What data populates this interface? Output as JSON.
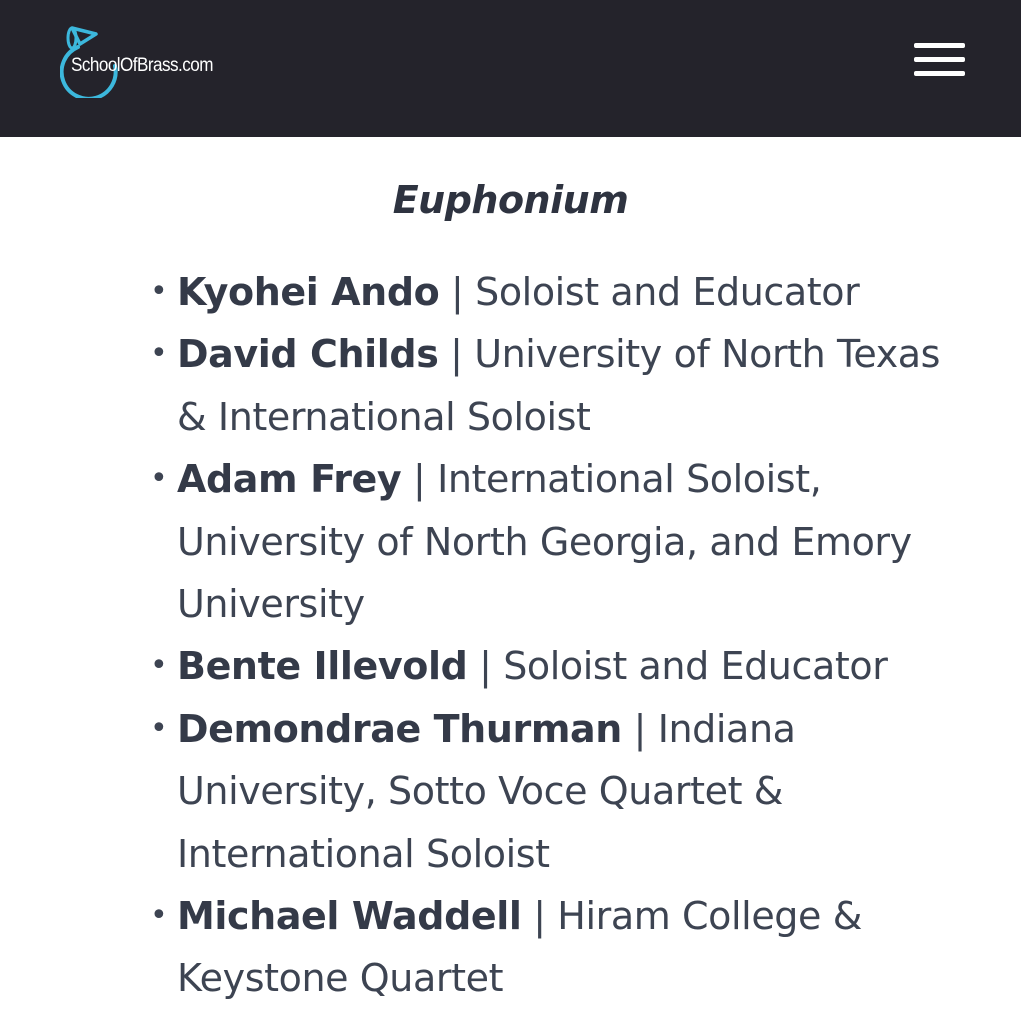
{
  "header": {
    "logo_text": "SchoolOfBrass.com",
    "menu_icon": "hamburger-menu-icon",
    "background_color": "#24232b"
  },
  "section": {
    "title": "Euphonium",
    "items": [
      {
        "name": "Kyohei Ando",
        "separator": " | ",
        "description": "Soloist and Educator"
      },
      {
        "name": "David Childs",
        "separator": " | ",
        "description": "University of North Texas & International Soloist"
      },
      {
        "name": "Adam Frey",
        "separator": " | ",
        "description": "International Soloist, University of North Georgia, and Emory University"
      },
      {
        "name": "Bente Illevold",
        "separator": " | ",
        "description": "Soloist and Educator"
      },
      {
        "name": "Demondrae Thurman",
        "separator": " | ",
        "description": "Indiana University, Sotto Voce Quartet & International Soloist"
      },
      {
        "name": "Michael Waddell",
        "separator": " | ",
        "description": "Hiram College & Keystone Quartet"
      }
    ]
  }
}
